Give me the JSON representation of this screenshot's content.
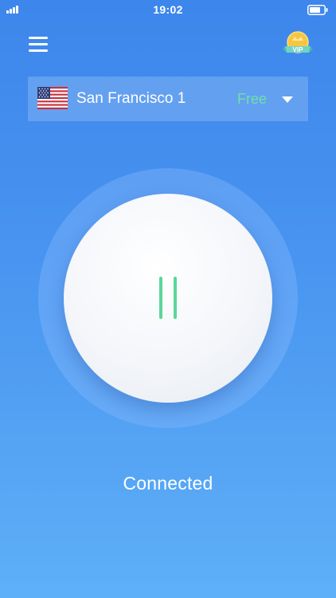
{
  "status_bar": {
    "time": "19:02",
    "signal_icon": "cellular-signal-icon",
    "battery_icon": "battery-icon"
  },
  "header": {
    "menu_icon": "hamburger-menu-icon",
    "vip_badge_text": "VIP"
  },
  "location": {
    "flag_icon": "us-flag-icon",
    "name": "San Francisco 1",
    "plan": "Free",
    "caret_icon": "caret-down-icon"
  },
  "connection": {
    "state_icon": "pause-icon",
    "status": "Connected"
  },
  "colors": {
    "background_top": "#3d86ec",
    "background_bottom": "#5eb0f8",
    "accent_green": "#5ad69a",
    "free_label": "#6fe1a9"
  }
}
